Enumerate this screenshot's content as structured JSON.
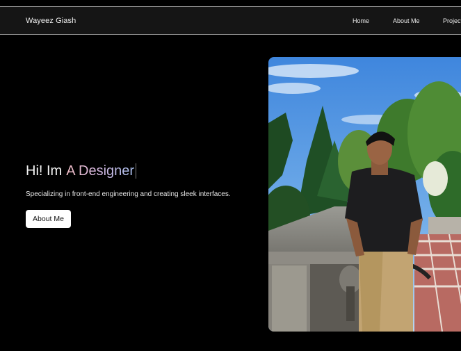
{
  "navbar": {
    "brand": "Wayeez Giash",
    "links": [
      "Home",
      "About Me",
      "Projects"
    ]
  },
  "hero": {
    "greeting": "Hi! Im",
    "typed_word": "A Designer",
    "subtitle": "Specializing in front-end engineering and creating sleek interfaces.",
    "cta_label": "About Me"
  },
  "photo": {
    "subject": "portrait of a young man in a black t-shirt and khaki trousers standing on a stone terrace in front of green trees"
  },
  "colors": {
    "background": "#000000",
    "navbar": "#151515",
    "gradient_start": "#f4c0c8",
    "gradient_end": "#a9c0ee",
    "button": "#ffffff"
  }
}
